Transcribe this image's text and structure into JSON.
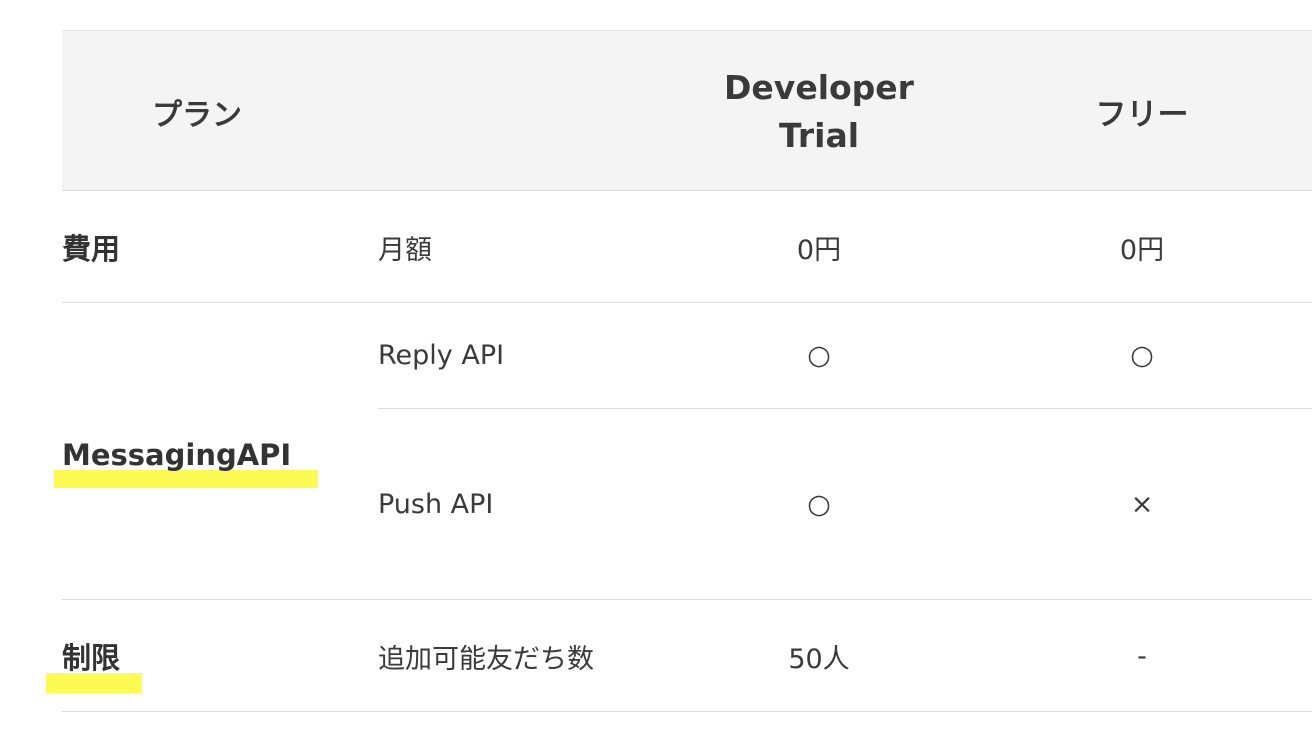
{
  "header": {
    "plan": "プラン",
    "developer_line1": "Developer",
    "developer_line2": "Trial",
    "free": "フリー"
  },
  "rows": {
    "cost": {
      "category": "費用",
      "item": "月額",
      "developer": "0円",
      "free": "0円"
    },
    "messaging": {
      "category": "MessagingAPI",
      "reply": {
        "item": "Reply API",
        "developer": "○",
        "free": "○"
      },
      "push": {
        "item": "Push API",
        "developer": "○",
        "free": "×"
      }
    },
    "limit": {
      "category": "制限",
      "item": "追加可能友だち数",
      "developer": "50人",
      "free": "-"
    }
  },
  "colors": {
    "header_bg": "#f4f4f4",
    "highlight": "#fdfa54",
    "text": "#333333",
    "divider": "#dadada"
  }
}
